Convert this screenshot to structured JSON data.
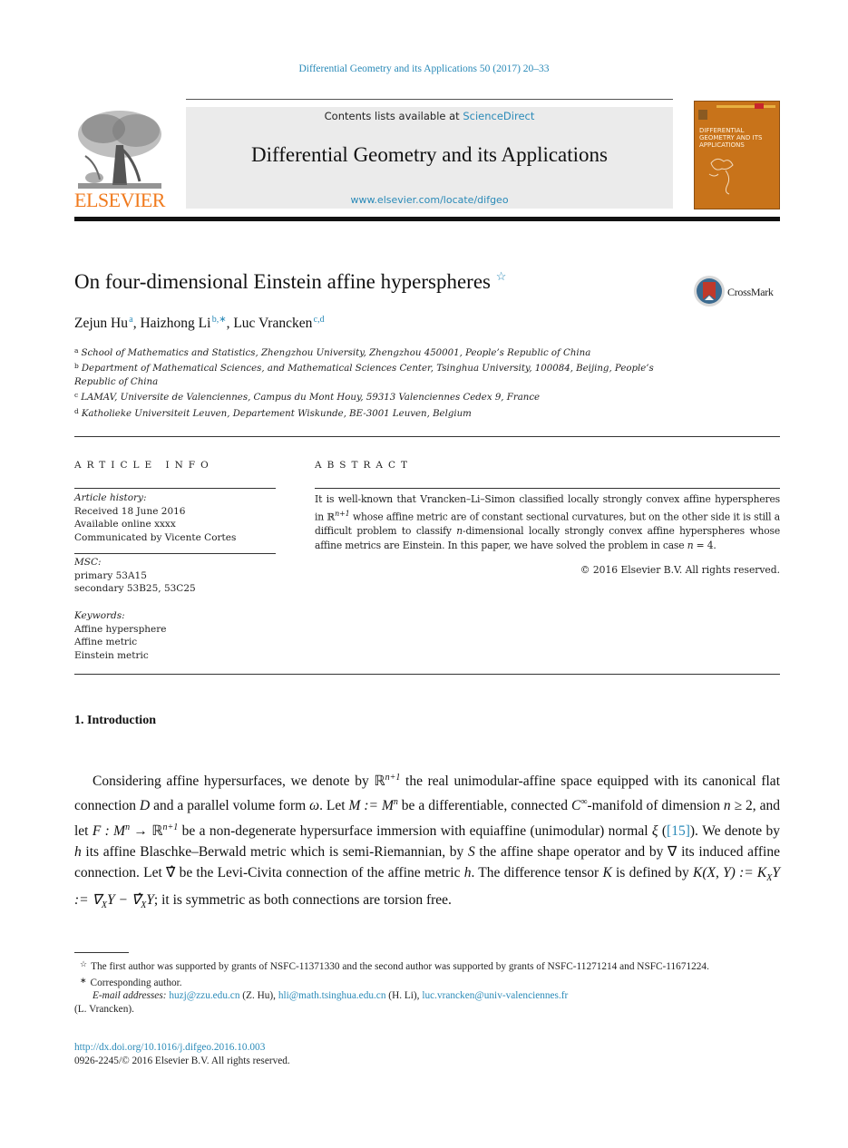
{
  "running_head": "Differential Geometry and its Applications 50 (2017) 20–33",
  "masthead": {
    "publisher_logo_text": "ELSEVIER",
    "contents_prefix": "Contents lists available at ",
    "contents_link": "ScienceDirect",
    "journal_title": "Differential Geometry and its Applications",
    "journal_url": "www.elsevier.com/locate/difgeo",
    "cover_title": "DIFFERENTIAL GEOMETRY AND ITS APPLICATIONS",
    "colors": {
      "elsevier_orange": "#f07a1d",
      "link_blue": "#2a8ab8",
      "cover_orange": "#c8731a"
    }
  },
  "article": {
    "title": "On four-dimensional Einstein affine hyperspheres",
    "title_mark": "☆",
    "crossmark_label": "CrossMark",
    "authors": [
      {
        "name": "Zejun Hu",
        "sup": "a"
      },
      {
        "name": "Haizhong Li",
        "sup": "b,∗"
      },
      {
        "name": "Luc Vrancken",
        "sup": "c,d"
      }
    ],
    "affiliations": [
      {
        "mark": "a",
        "text": "School of Mathematics and Statistics, Zhengzhou University, Zhengzhou 450001, People’s Republic of China"
      },
      {
        "mark": "b",
        "text": "Department of Mathematical Sciences, and Mathematical Sciences Center, Tsinghua University, 100084, Beijing, People’s Republic of China"
      },
      {
        "mark": "c",
        "text": "LAMAV, Universite de Valenciennes, Campus du Mont Houy, 59313 Valenciennes Cedex 9, France"
      },
      {
        "mark": "d",
        "text": "Katholieke Universiteit Leuven, Departement Wiskunde, BE-3001 Leuven, Belgium"
      }
    ]
  },
  "article_info": {
    "heading": "ARTICLE INFO",
    "history_label": "Article history:",
    "history": [
      "Received 18 June 2016",
      "Available online xxxx",
      "Communicated by Vicente Cortes"
    ],
    "msc_label": "MSC:",
    "msc": [
      "primary 53A15",
      "secondary 53B25, 53C25"
    ],
    "keywords_label": "Keywords:",
    "keywords": [
      "Affine hypersphere",
      "Affine metric",
      "Einstein metric"
    ]
  },
  "abstract": {
    "heading": "ABSTRACT",
    "text_1": "It is well-known that Vrancken–Li–Simon classified locally strongly convex affine hyperspheres in ",
    "space": "ℝ",
    "space_sup": "n+1",
    "text_2": " whose affine metric are of constant sectional curvatures, but on the other side it is still a difficult problem to classify ",
    "n_var": "n",
    "text_3": "-dimensional locally strongly convex affine hyperspheres whose affine metrics are Einstein. In this paper, we have solved the problem in case ",
    "text_4": " = 4.",
    "copyright": "© 2016 Elsevier B.V. All rights reserved."
  },
  "introduction": {
    "heading": "1. Introduction",
    "p1_a": "Considering affine hypersurfaces, we denote by ℝ",
    "p1_sup1": "n+1",
    "p1_b": " the real unimodular-affine space equipped with its canonical flat connection ",
    "p1_D": "D",
    "p1_c": " and a parallel volume form ",
    "p1_omega": "ω",
    "p1_d": ". Let ",
    "p1_M": "M := M",
    "p1_sup2": "n",
    "p1_e": " be a differentiable, connected ",
    "p1_C": "C",
    "p1_sup3": "∞",
    "p1_f": "-manifold of dimension ",
    "p1_n": "n",
    "p1_g": " ≥ 2, and let ",
    "p1_F": "F : M",
    "p1_sup4": "n",
    "p1_h": " → ℝ",
    "p1_sup5": "n+1",
    "p1_i": " be a non-degenerate hypersurface immersion with equiaffine (unimodular) normal ",
    "p1_xi": "ξ",
    "p1_j": " (",
    "p1_ref": "[15]",
    "p1_k": "). We denote by ",
    "p1_h_var": "h",
    "p1_l": " its affine Blaschke–Berwald metric which is semi-Riemannian, by ",
    "p1_S": "S",
    "p1_m": " the affine shape operator and by ∇ its induced affine connection. Let ∇̂ be the Levi-Civita connection of the affine metric ",
    "p1_h2": "h",
    "p1_o": ". The difference tensor ",
    "p1_K": "K",
    "p1_p": " is defined by ",
    "p1_formula": "K(X, Y) := K",
    "p1_sub1": "X",
    "p1_formula2": "Y := ∇",
    "p1_sub2": "X",
    "p1_formula3": "Y − ∇̂",
    "p1_sub3": "X",
    "p1_formula4": "Y",
    "p1_q": "; it is symmetric as both connections are torsion free."
  },
  "footnotes": {
    "star_mark": "☆",
    "star_text": "The first author was supported by grants of NSFC-11371330 and the second author was supported by grants of NSFC-11271214 and NSFC-11671224.",
    "corr_mark": "∗",
    "corr_text": "Corresponding author.",
    "email_label": "E-mail addresses:",
    "emails": [
      {
        "address": "huzj@zzu.edu.cn",
        "owner": " (Z. Hu), "
      },
      {
        "address": "hli@math.tsinghua.edu.cn",
        "owner": " (H. Li), "
      },
      {
        "address": "luc.vrancken@univ-valenciennes.fr",
        "owner": " (L. Vrancken)."
      }
    ],
    "doi": "http://dx.doi.org/10.1016/j.difgeo.2016.10.003",
    "issn_line": "0926-2245/© 2016 Elsevier B.V. All rights reserved."
  }
}
